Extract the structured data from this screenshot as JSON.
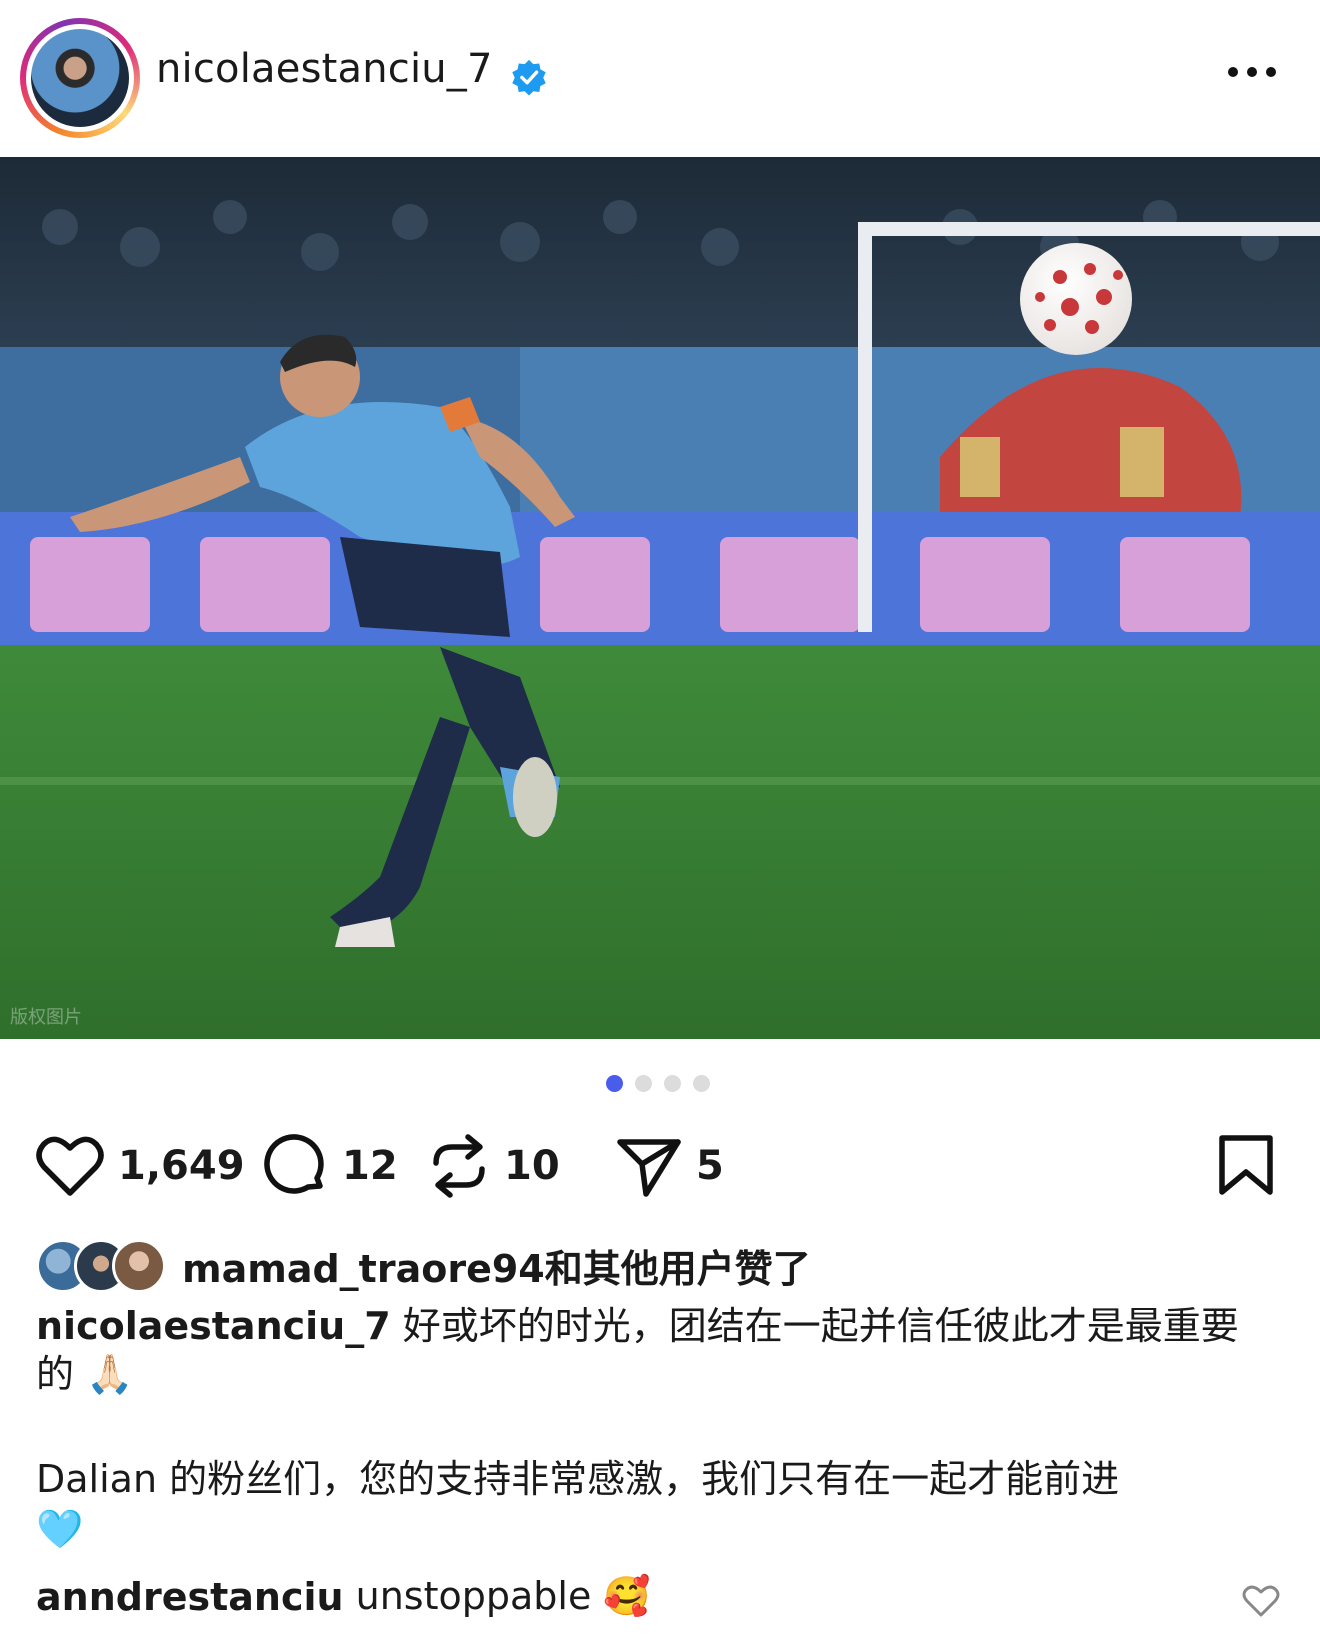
{
  "post": {
    "username": "nicolaestanciu_7",
    "verified_icon": "verified-badge-icon",
    "more_icon": "more-options-icon"
  },
  "carousel": {
    "total": 4,
    "active": 1
  },
  "actions": {
    "likes": "1,649",
    "comments": "12",
    "reposts": "10",
    "shares": "5"
  },
  "liked_by": {
    "user": "mamad_traore94",
    "suffix": "和其他用户赞了"
  },
  "caption": {
    "username": "nicolaestanciu_7",
    "line1": "好或坏的时光，团结在一起并信任彼此才是最重要的 🙏🏻",
    "line2": " Dalian 的粉丝们，您的支持非常感激，我们只有在一起才能前进",
    "emoji2": "🩵"
  },
  "comment": {
    "username": "anndrestanciu",
    "text": "unstoppable 🥰"
  },
  "photo_watermark": "版权图片",
  "colors": {
    "accent": "#4a5dea",
    "verified": "#1d9bf0",
    "jersey": "#5da4dc"
  }
}
